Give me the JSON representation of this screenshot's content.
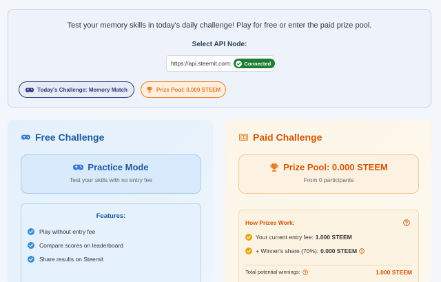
{
  "header": {
    "description": "Test your memory skills in today's daily challenge! Play for free or enter the paid prize pool.",
    "api_label": "Select API Node:",
    "api_node": "https://api.steemit.com:",
    "api_status": "Connected",
    "challenge_pill": "Today's Challenge: Memory Match",
    "prize_pill": "Prize Pool: 0.000 STEEM"
  },
  "free": {
    "title": "Free Challenge",
    "mode_title": "Practice Mode",
    "mode_subtitle": "Test your skills with no entry fee",
    "features_title": "Features:",
    "features": [
      "Play without entry fee",
      "Compare scores on leaderboard",
      "Share results on Steemit"
    ]
  },
  "paid": {
    "title": "Paid Challenge",
    "prize_title": "Prize Pool: 0.000 STEEM",
    "participants": "From 0 participants",
    "how_title": "How Prizes Work:",
    "entry_fee_label": "Your current entry fee:",
    "entry_fee_value": "1.000 STEEM",
    "winner_share_label": "+ Winner's share (70%):",
    "winner_share_value": "0.000 STEEM",
    "total_label": "Total potential winnings:",
    "total_value": "1.000 STEEM"
  },
  "colors": {
    "free_accent": "#1e5aa0",
    "paid_accent": "#d35400",
    "check_blue": "#3a8fd6",
    "check_orange": "#e8a317",
    "connected": "#1e7e34"
  }
}
